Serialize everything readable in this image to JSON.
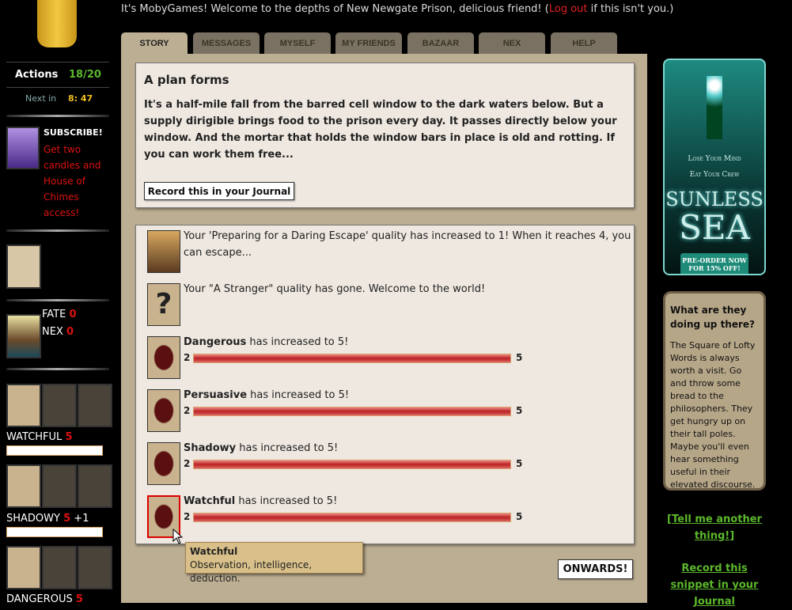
{
  "header": {
    "welcome_pre": "It's MobyGames! Welcome to the depths of New Newgate Prison, delicious friend! (",
    "logout": "Log out",
    "welcome_post": " if this isn't you.)"
  },
  "tabs": [
    "STORY",
    "MESSAGES",
    "MYSELF",
    "MY FRIENDS",
    "BAZAAR",
    "NEX",
    "HELP"
  ],
  "sidebar": {
    "actions_label": "Actions",
    "actions_value": "18/20",
    "next_label": "Next in",
    "next_value": "8: 47",
    "subscribe_title": "SUBSCRIBE!",
    "subscribe_text": "Get two candles and House of Chimes access!",
    "fate_label": "FATE",
    "fate_value": "0",
    "nex_label": "NEX",
    "nex_value": "0",
    "qualities": [
      {
        "name": "WATCHFUL",
        "value": "5",
        "bonus": ""
      },
      {
        "name": "SHADOWY",
        "value": "5",
        "bonus": "+1"
      },
      {
        "name": "DANGEROUS",
        "value": "5",
        "bonus": ""
      }
    ]
  },
  "story": {
    "title": "A plan forms",
    "text": "It's a half-mile fall from the barred cell window to the dark waters below. But a supply dirigible brings food to the prison every day. It passes directly below your window. And the mortar that holds the window bars in place is old and rotting. If you can work them free...",
    "record_button": "Record this in your Journal"
  },
  "results": [
    {
      "icon": "airship-icon",
      "text": "Your 'Preparing for a Daring Escape' quality has increased to 1! When it reaches 4, you can escape..."
    },
    {
      "icon": "question-mark-icon",
      "text": "Your \"A Stranger\" quality has gone. Welcome to the world!"
    },
    {
      "icon": "bear-icon",
      "bold": "Dangerous",
      "text": " has increased to 5!",
      "from": "2",
      "to": "5",
      "progress": 1.0
    },
    {
      "icon": "fox-icon",
      "bold": "Persuasive",
      "text": " has increased to 5!",
      "from": "2",
      "to": "5",
      "progress": 1.0
    },
    {
      "icon": "cat-icon",
      "bold": "Shadowy",
      "text": " has increased to 5!",
      "from": "2",
      "to": "5",
      "progress": 1.0
    },
    {
      "icon": "owl-icon",
      "bold": "Watchful",
      "text": " has increased to 5!",
      "from": "2",
      "to": "5",
      "progress": 1.0
    }
  ],
  "tooltip": {
    "title": "Watchful",
    "text": "Observation, intelligence, deduction."
  },
  "onwards": "ONWARDS!",
  "ad": {
    "line1": "Lose Your Mind",
    "line2": "Eat Your Crew",
    "title1": "SUNLESS",
    "title2": "SEA",
    "cta": "PRE-ORDER NOW FOR 15% OFF!"
  },
  "tip": {
    "title": "What are they doing up there?",
    "text": "The Square of Lofty Words is always worth a visit. Go and throw some bread to the philosophers. They get hungry up on their tall poles. Maybe you'll even hear something useful in their elevated discourse."
  },
  "links": {
    "tell_me": "[Tell me another thing!]",
    "record_snippet": "Record this snippet in your Journal"
  },
  "colors": {
    "accent_green": "#5cb82c",
    "danger_red": "#d11",
    "panel_tan": "#bcae92"
  }
}
